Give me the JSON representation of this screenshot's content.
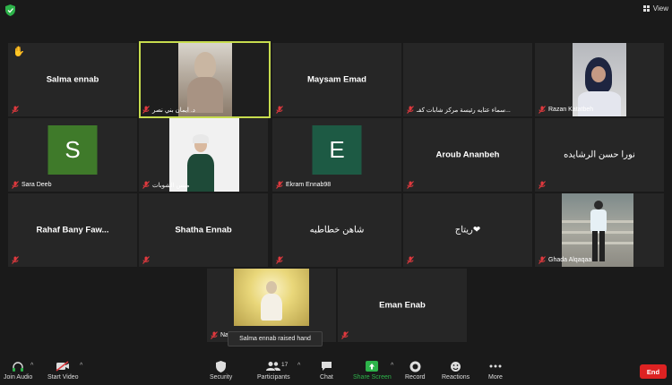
{
  "topbar": {
    "view_label": "View"
  },
  "colors": {
    "active_border": "#c7dc4e",
    "end_button": "#dd2222",
    "share_green": "#2db34a",
    "mic_muted": "#e0393e"
  },
  "participants": [
    {
      "name": "Salma ennab",
      "label": "",
      "raised_hand": true
    },
    {
      "name": "",
      "label": "د. ايمان بني نصر"
    },
    {
      "name": "Maysam Emad",
      "label": ""
    },
    {
      "name": "",
      "label": "سماء عتايه رئيسة مركز شابات كفـ..."
    },
    {
      "name": "",
      "label": "Razan Katatbeh"
    },
    {
      "name": "",
      "label": "Sara Deeb",
      "initial": "S"
    },
    {
      "name": "",
      "label": "ميس الشوبات"
    },
    {
      "name": "",
      "label": "Ekram Ennab98",
      "initial": "E"
    },
    {
      "name": "Aroub Ananbeh",
      "label": ""
    },
    {
      "name": "نورا حسن الرشايده",
      "label": ""
    },
    {
      "name": "Rahaf Bany Faw...",
      "label": ""
    },
    {
      "name": "Shatha Ennab",
      "label": ""
    },
    {
      "name": "شاهن خطاطبه",
      "label": ""
    },
    {
      "name": "ريتاج❤",
      "label": ""
    },
    {
      "name": "",
      "label": "Ghada Alqaqaa"
    },
    {
      "name": "",
      "label": "Naj..."
    },
    {
      "name": "Eman Enab",
      "label": ""
    }
  ],
  "toast": "Salma ennab raised hand",
  "toolbar": {
    "join_audio": "Join Audio",
    "start_video": "Start Video",
    "security": "Security",
    "participants": "Participants",
    "participants_count": "17",
    "chat": "Chat",
    "share_screen": "Share Screen",
    "record": "Record",
    "reactions": "Reactions",
    "more": "More",
    "end": "End"
  }
}
